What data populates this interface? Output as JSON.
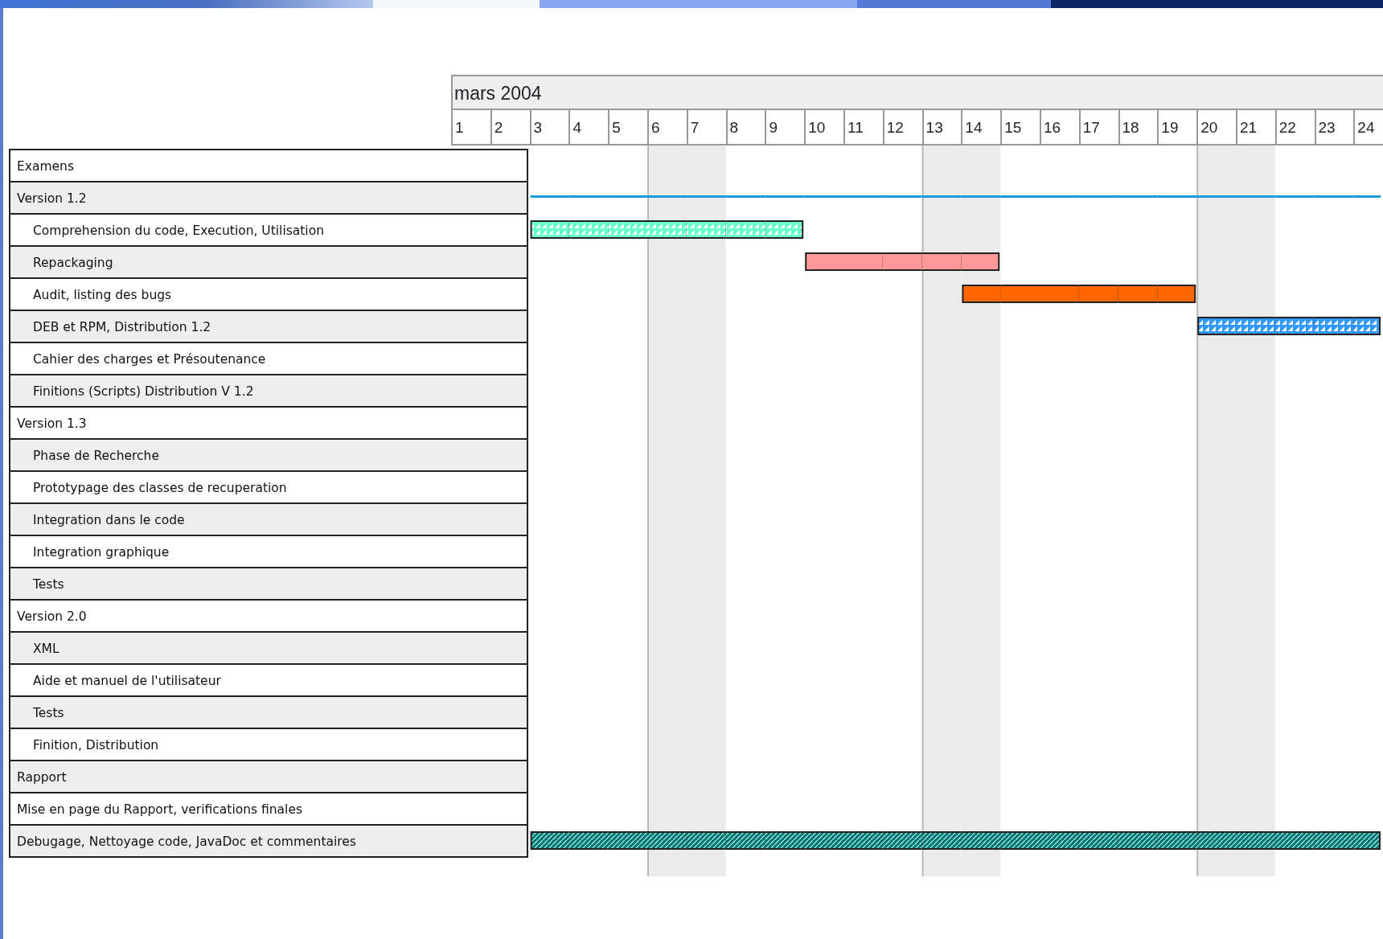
{
  "timeline": {
    "month": "mars  2004",
    "days": [
      {
        "label": "1",
        "weekend": false
      },
      {
        "label": "2",
        "weekend": false
      },
      {
        "label": "3",
        "weekend": false
      },
      {
        "label": "4",
        "weekend": false
      },
      {
        "label": "5",
        "weekend": false
      },
      {
        "label": "6",
        "weekend": true
      },
      {
        "label": "7",
        "weekend": true
      },
      {
        "label": "8",
        "weekend": false
      },
      {
        "label": "9",
        "weekend": false
      },
      {
        "label": "10",
        "weekend": false
      },
      {
        "label": "11",
        "weekend": false
      },
      {
        "label": "12",
        "weekend": false
      },
      {
        "label": "13",
        "weekend": true
      },
      {
        "label": "14",
        "weekend": true
      },
      {
        "label": "15",
        "weekend": false
      },
      {
        "label": "16",
        "weekend": false
      },
      {
        "label": "17",
        "weekend": false
      },
      {
        "label": "18",
        "weekend": false
      },
      {
        "label": "19",
        "weekend": false
      },
      {
        "label": "20",
        "weekend": true
      },
      {
        "label": "21",
        "weekend": true
      },
      {
        "label": "22",
        "weekend": false
      },
      {
        "label": "23",
        "weekend": false
      },
      {
        "label": "24",
        "weekend": false
      }
    ]
  },
  "tasks": [
    {
      "label": "Examens"
    },
    {
      "label": "Version 1.2",
      "bar": {
        "kind": "line",
        "color": "#1a9ad6",
        "days": [
          true,
          true,
          true,
          true,
          true,
          true,
          true,
          true,
          true,
          true,
          true,
          true,
          true,
          true,
          true,
          true,
          true,
          true,
          true,
          true,
          true,
          true
        ]
      },
      "children": [
        {
          "label": "Comprehension du code, Execution, Utilisation",
          "bar": {
            "kind": "checker",
            "color": "#66ffcc",
            "days": [
              true,
              true,
              true,
              true,
              true,
              true,
              true,
              false,
              false,
              false,
              false,
              false,
              false,
              false,
              false,
              false,
              false,
              false,
              false,
              false,
              false,
              false
            ]
          }
        },
        {
          "label": "Repackaging",
          "bar": {
            "kind": "solid",
            "color": "#ff9999",
            "days": [
              false,
              false,
              false,
              false,
              false,
              false,
              false,
              true,
              true,
              true,
              true,
              true,
              false,
              false,
              false,
              false,
              false,
              false,
              false,
              false,
              false,
              false
            ]
          }
        },
        {
          "label": "Audit, listing des bugs",
          "bar": {
            "kind": "solid",
            "color": "#ff6600",
            "days": [
              false,
              false,
              false,
              false,
              false,
              false,
              false,
              false,
              false,
              false,
              false,
              true,
              true,
              true,
              true,
              true,
              true,
              false,
              false,
              false,
              false,
              false
            ]
          }
        },
        {
          "label": "DEB et RPM, Distribution 1.2",
          "bar": {
            "kind": "checker",
            "color": "#3399ff",
            "days": [
              false,
              false,
              false,
              false,
              false,
              false,
              false,
              false,
              false,
              false,
              false,
              false,
              false,
              false,
              false,
              false,
              false,
              true,
              true,
              true,
              true,
              true
            ]
          }
        },
        {
          "label": "Cahier des charges et Présoutenance"
        },
        {
          "label": "Finitions (Scripts) Distribution V 1.2"
        }
      ]
    },
    {
      "label": "Version 1.3",
      "children": [
        {
          "label": "Phase de Recherche"
        },
        {
          "label": "Prototypage des classes de recuperation"
        },
        {
          "label": "Integration dans le code"
        },
        {
          "label": "Integration graphique"
        },
        {
          "label": "Tests"
        }
      ]
    },
    {
      "label": "Version 2.0",
      "children": [
        {
          "label": "XML"
        },
        {
          "label": "Aide et manuel de l'utilisateur"
        },
        {
          "label": "Tests"
        },
        {
          "label": "Finition, Distribution"
        }
      ]
    },
    {
      "label": "Rapport"
    },
    {
      "label": "Mise en page du Rapport, verifications finales"
    },
    {
      "label": "Debugage, Nettoyage code, JavaDoc et commentaires",
      "bar": {
        "kind": "hatch",
        "color": "#007777",
        "days": [
          true,
          true,
          true,
          true,
          true,
          true,
          true,
          true,
          true,
          true,
          true,
          true,
          true,
          true,
          true,
          true,
          true,
          true,
          true,
          true,
          true,
          true
        ]
      }
    }
  ]
}
